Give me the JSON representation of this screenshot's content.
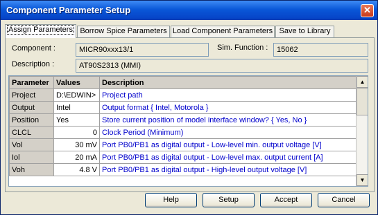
{
  "window": {
    "title": "Component Parameter Setup",
    "close_glyph": "✕"
  },
  "tabs": [
    {
      "label": "Assign Parameters"
    },
    {
      "label": "Borrow Spice Parameters"
    },
    {
      "label": "Load Component Parameters"
    },
    {
      "label": "Save to Library"
    }
  ],
  "component": {
    "label": "Component :",
    "value": "MICR90xxx13/1"
  },
  "sim_function": {
    "label": "Sim. Function :",
    "value": "15062"
  },
  "description": {
    "label": "Description :",
    "value": "AT90S2313 (MMI)"
  },
  "grid": {
    "headers": [
      "Parameter",
      "Values",
      "Description"
    ],
    "rows": [
      {
        "param": "Project",
        "value": "D:\\EDWIN>",
        "desc": "Project path"
      },
      {
        "param": "Output",
        "value": "Intel",
        "desc": "Output format { Intel, Motorola }"
      },
      {
        "param": "Position",
        "value": "Yes",
        "desc": "Store current position of model interface window? { Yes, No }"
      },
      {
        "param": "CLCL",
        "value": "0",
        "desc": "Clock Period (Minimum)"
      },
      {
        "param": "Vol",
        "value": "30 mV",
        "desc": "Port PB0/PB1 as digital output - Low-level min. output voltage [V]"
      },
      {
        "param": "Iol",
        "value": "20 mA",
        "desc": "Port PB0/PB1 as digital output - Low-level max. output current [A]"
      },
      {
        "param": "Voh",
        "value": "4.8 V",
        "desc": "Port PB0/PB1 as digital output - High-level output voltage [V]"
      }
    ]
  },
  "scrollbar": {
    "up_glyph": "▲",
    "down_glyph": "▼"
  },
  "buttons": {
    "help": "Help",
    "setup": "Setup",
    "accept": "Accept",
    "cancel": "Cancel"
  }
}
